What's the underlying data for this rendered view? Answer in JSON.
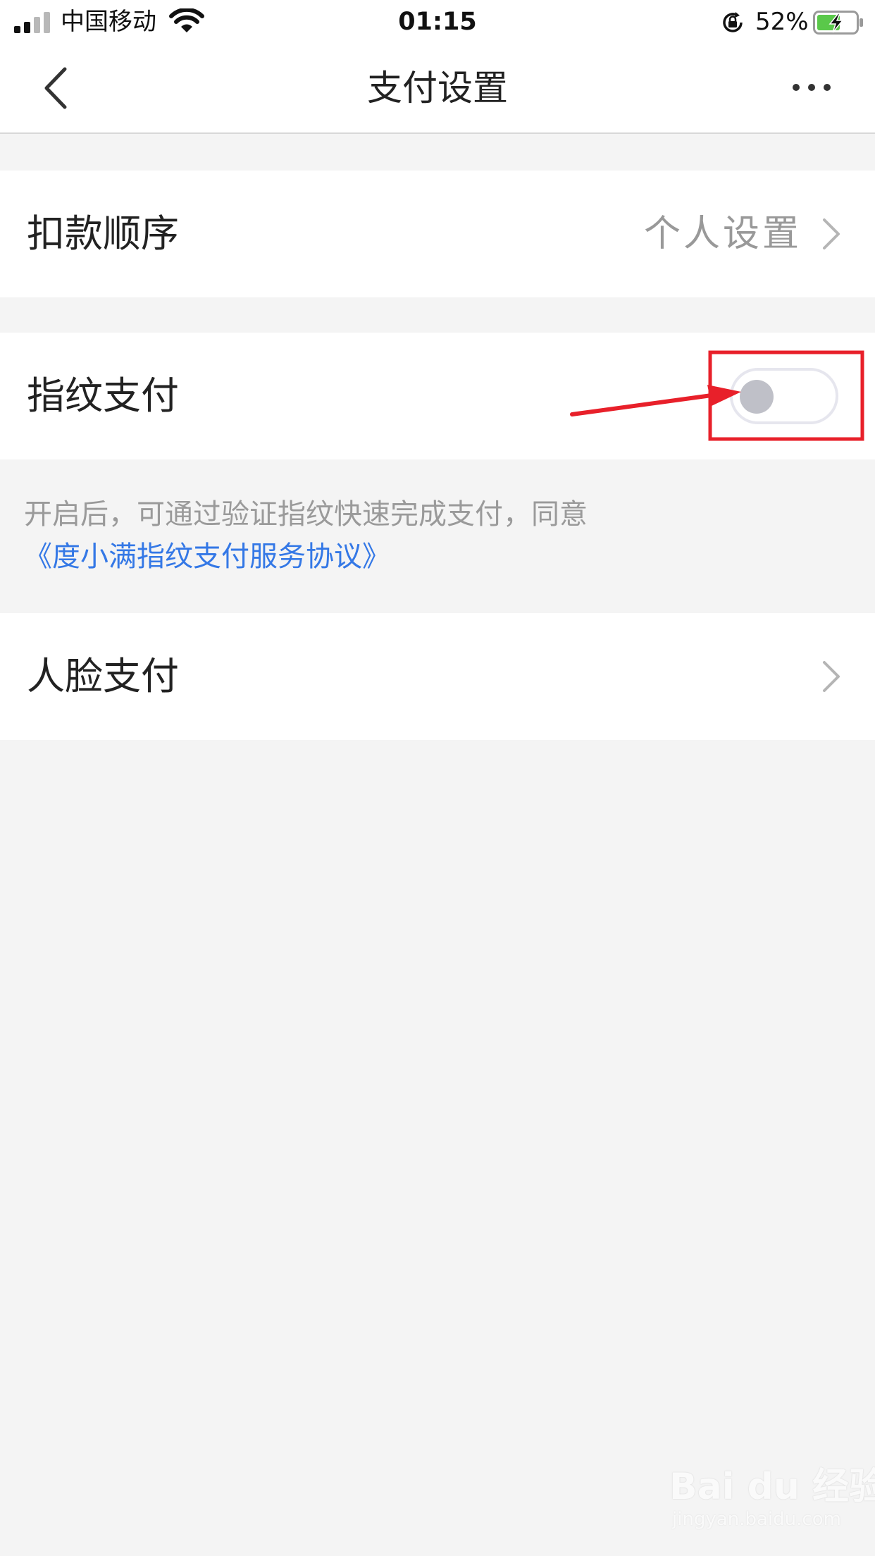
{
  "status_bar": {
    "carrier": "中国移动",
    "time": "01:15",
    "battery_percent": "52%",
    "icons": [
      "signal-icon",
      "wifi-icon",
      "rotation-lock-icon",
      "battery-charging-icon"
    ]
  },
  "nav": {
    "title": "支付设置",
    "icons": [
      "chevron-left-icon",
      "more-icon"
    ]
  },
  "settings": {
    "deduct_order": {
      "label": "扣款顺序",
      "value": "个人设置"
    },
    "fingerprint_pay": {
      "label": "指纹支付",
      "enabled": false
    },
    "fingerprint_hint": {
      "text": "开启后，可通过验证指纹快速完成支付，同意",
      "link": "《度小满指纹支付服务协议》"
    },
    "face_pay": {
      "label": "人脸支付"
    }
  },
  "watermark": {
    "main": "Bai du 经验",
    "sub": "jingyan.baidu.com"
  },
  "colors": {
    "link": "#3478e6",
    "annotation": "#e8202a",
    "background": "#f4f4f4",
    "toggle_off_knob": "#bfc0c8",
    "battery_charge": "#5ac84a"
  }
}
